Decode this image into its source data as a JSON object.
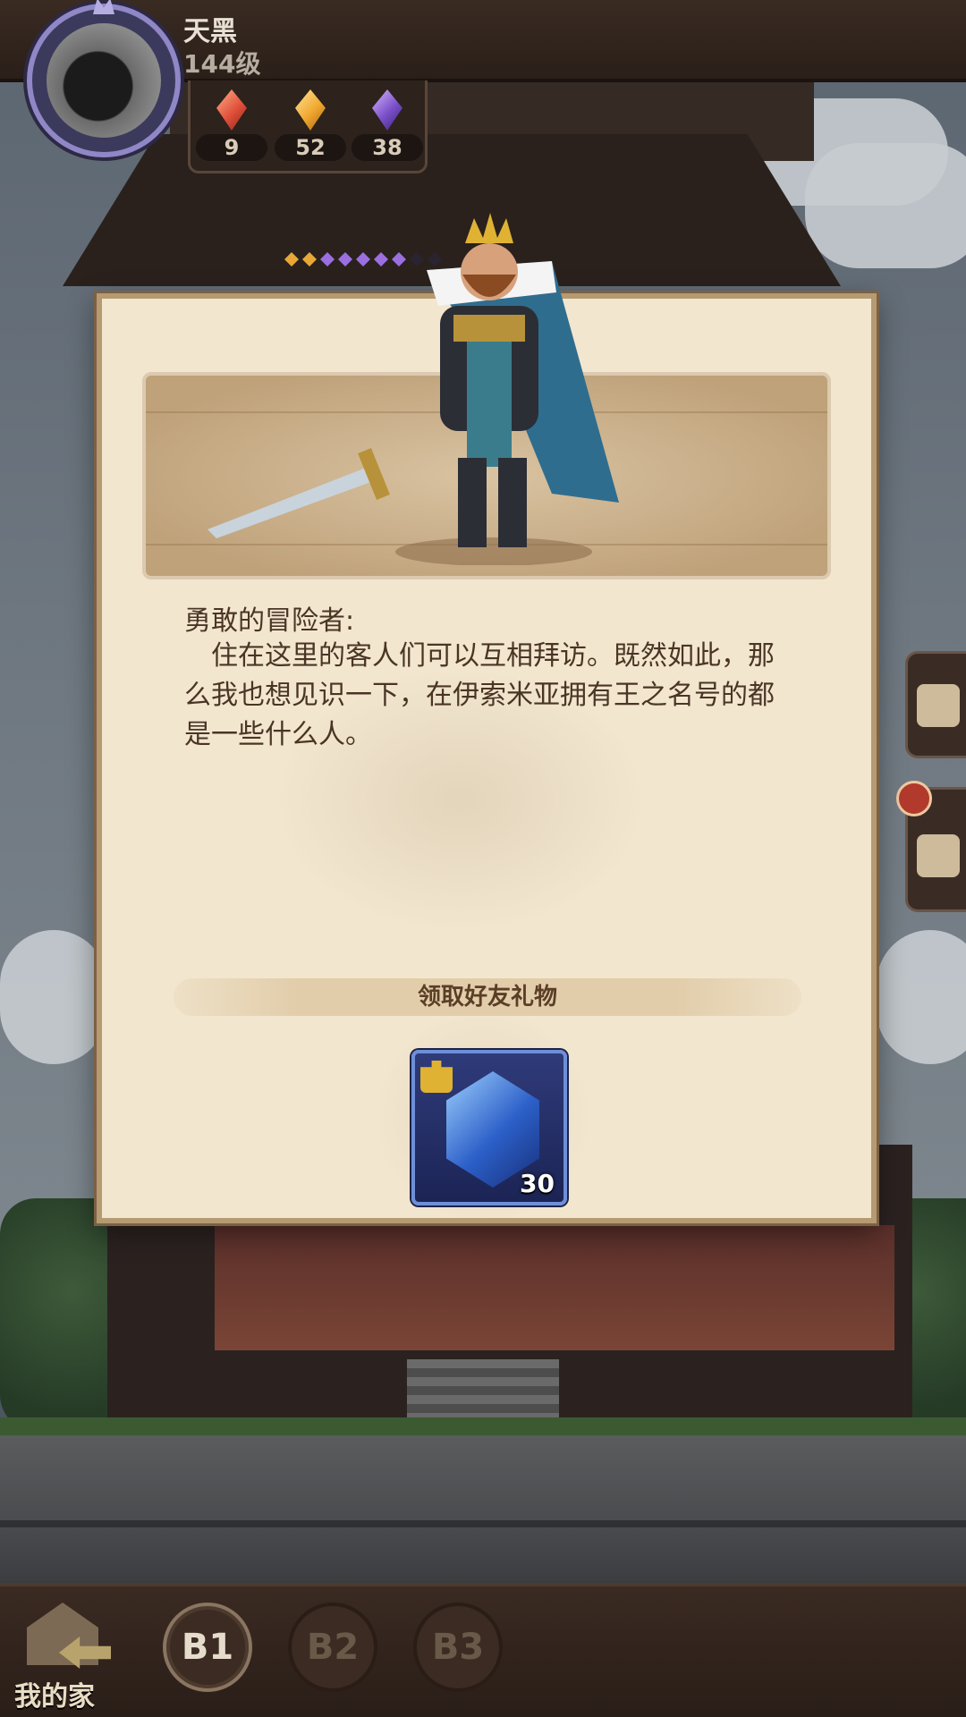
{
  "player": {
    "name": "天黑",
    "level": "144级"
  },
  "currencies": [
    {
      "icon": "red-gem-icon",
      "value": "9",
      "color": "#e0503a"
    },
    {
      "icon": "gold-gem-icon",
      "value": "52",
      "color": "#f0a830"
    },
    {
      "icon": "purple-gem-icon",
      "value": "38",
      "color": "#7a4fc8"
    }
  ],
  "dialog": {
    "speaker": "勇敢的冒险者:",
    "message": "住在这里的客人们可以互相拜访。既然如此，那么我也想见识一下，在伊索米亚拥有王之名号的都是一些什么人。",
    "gift_title": "领取好友礼物",
    "reward": {
      "icon": "crystal-fragment-icon",
      "count": "30"
    }
  },
  "bottom_nav": {
    "home_label": "我的家",
    "floors": [
      "B1",
      "B2",
      "B3"
    ],
    "active_floor": "B1"
  }
}
